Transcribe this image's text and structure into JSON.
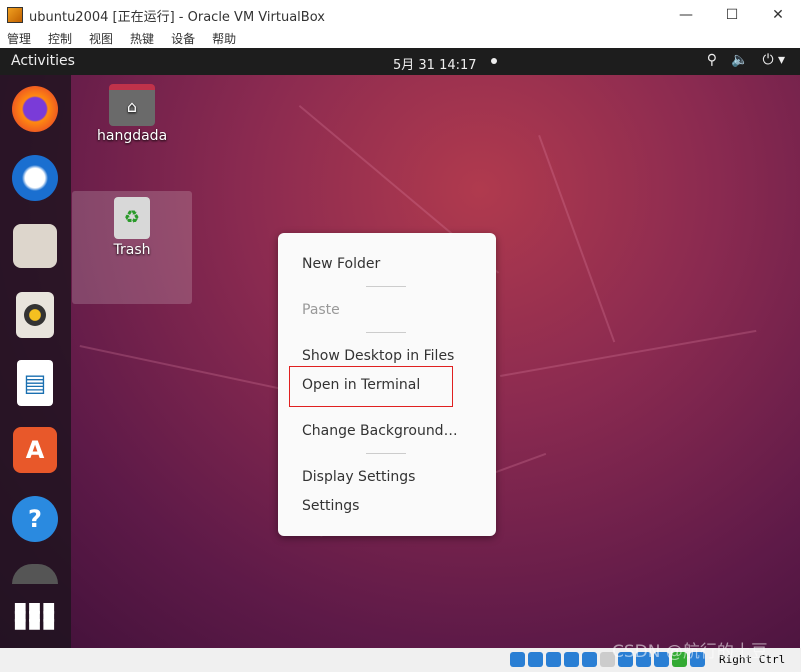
{
  "window": {
    "title": "ubuntu2004 [正在运行] - Oracle VM VirtualBox",
    "minimize": "—",
    "maximize": "☐",
    "close": "✕"
  },
  "menu": [
    "管理",
    "控制",
    "视图",
    "热键",
    "设备",
    "帮助"
  ],
  "topbar": {
    "activities": "Activities",
    "clock": "5月 31  14:17",
    "network": "⯈",
    "power": "⏻ ▾"
  },
  "dock": [
    {
      "name": "firefox"
    },
    {
      "name": "thunderbird"
    },
    {
      "name": "files"
    },
    {
      "name": "rhythmbox"
    },
    {
      "name": "libreoffice-writer",
      "glyph": "▤"
    },
    {
      "name": "software",
      "glyph": "A"
    },
    {
      "name": "help",
      "glyph": "?"
    },
    {
      "name": "app-grid",
      "glyph": "⋮⋮⋮"
    }
  ],
  "desktop": {
    "home_label": "hangdada",
    "trash_label": "Trash"
  },
  "context_menu": {
    "new_folder": "New Folder",
    "paste": "Paste",
    "show_desktop": "Show Desktop in Files",
    "open_terminal": "Open in Terminal",
    "change_background": "Change Background…",
    "display_settings": "Display Settings",
    "settings": "Settings"
  },
  "statusbar": {
    "host_key": "Right Ctrl"
  },
  "watermark": "CSDN @航行的土豆"
}
